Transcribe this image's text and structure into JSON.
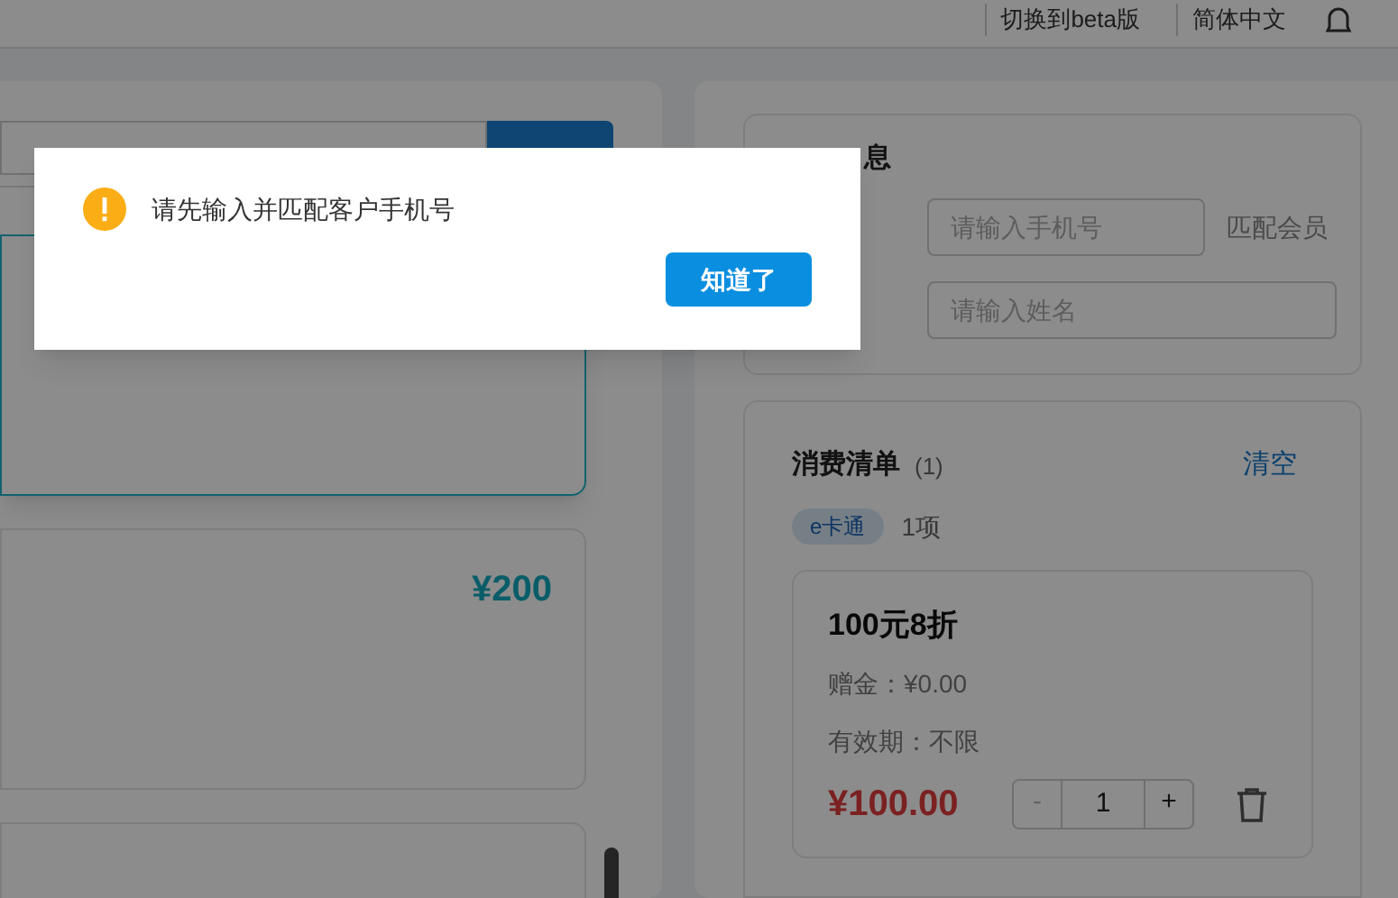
{
  "header": {
    "links": [
      "切换到beta版",
      "简体中文"
    ]
  },
  "packages": [
    {
      "selected": true
    },
    {
      "price": "¥200",
      "selected": false
    },
    {
      "selected": false
    }
  ],
  "member": {
    "title": "息",
    "phone_placeholder": "请输入手机号",
    "match_label": "匹配会员",
    "name_placeholder": "请输入姓名"
  },
  "order": {
    "title": "消费清单",
    "count": "(1)",
    "clear": "清空",
    "tag": "e卡通",
    "tag_count": "1项",
    "items": [
      {
        "name": "100元8折",
        "bonus": "赠金：¥0.00",
        "validity": "有效期：不限",
        "price": "¥100.00",
        "minus": "-",
        "qty": "1",
        "plus": "+"
      }
    ]
  },
  "dialog": {
    "message": "请先输入并匹配客户手机号",
    "button": "知道了"
  }
}
